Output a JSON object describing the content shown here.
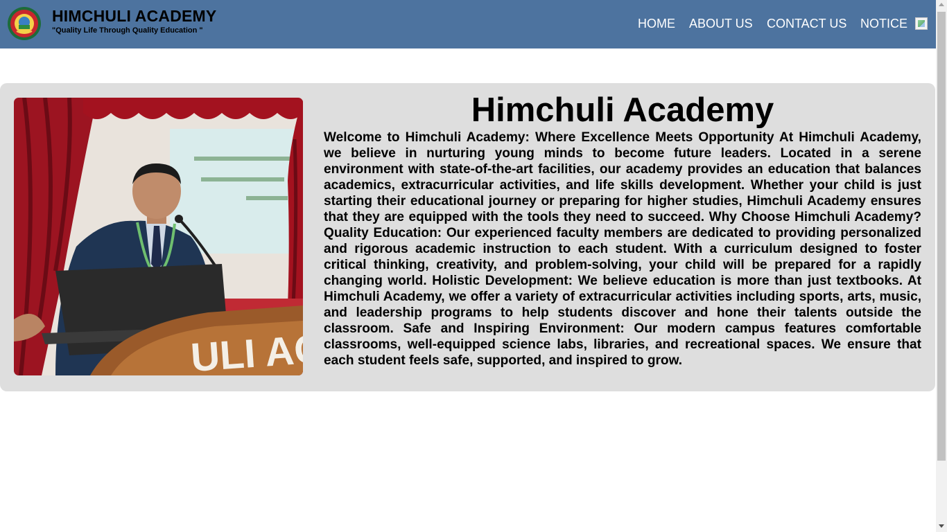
{
  "header": {
    "title": "HIMCHULI ACADEMY",
    "tagline": "\"Quality Life Through Quality Education \"",
    "logo_icon": "school-emblem-logo",
    "bg_color": "#4d739f"
  },
  "nav": {
    "home": "HOME",
    "about": "ABOUT US",
    "contact": "CONTACT US",
    "notice": "NOTICE",
    "notice_icon": "broken-image-icon"
  },
  "main": {
    "heading": "Himchuli Academy",
    "photo": "speaker-at-podium-photo",
    "body": "Welcome to Himchuli Academy: Where Excellence Meets Opportunity At Himchuli Academy, we believe in nurturing young minds to become future leaders. Located in a serene environment with state-of-the-art facilities, our academy provides an education that balances academics, extracurricular activities, and life skills development. Whether your child is just starting their educational journey or preparing for higher studies, Himchuli Academy ensures that they are equipped with the tools they need to succeed. Why Choose Himchuli Academy? Quality Education: Our experienced faculty members are dedicated to providing personalized and rigorous academic instruction to each student. With a curriculum designed to foster critical thinking, creativity, and problem-solving, your child will be prepared for a rapidly changing world. Holistic Development: We believe education is more than just textbooks. At Himchuli Academy, we offer a variety of extracurricular activities including sports, arts, music, and leadership programs to help students discover and hone their talents outside the classroom. Safe and Inspiring Environment: Our modern campus features comfortable classrooms, well-equipped science labs, libraries, and recreational spaces. We ensure that each student feels safe, supported, and inspired to grow.",
    "panel_color": "#dedede"
  }
}
